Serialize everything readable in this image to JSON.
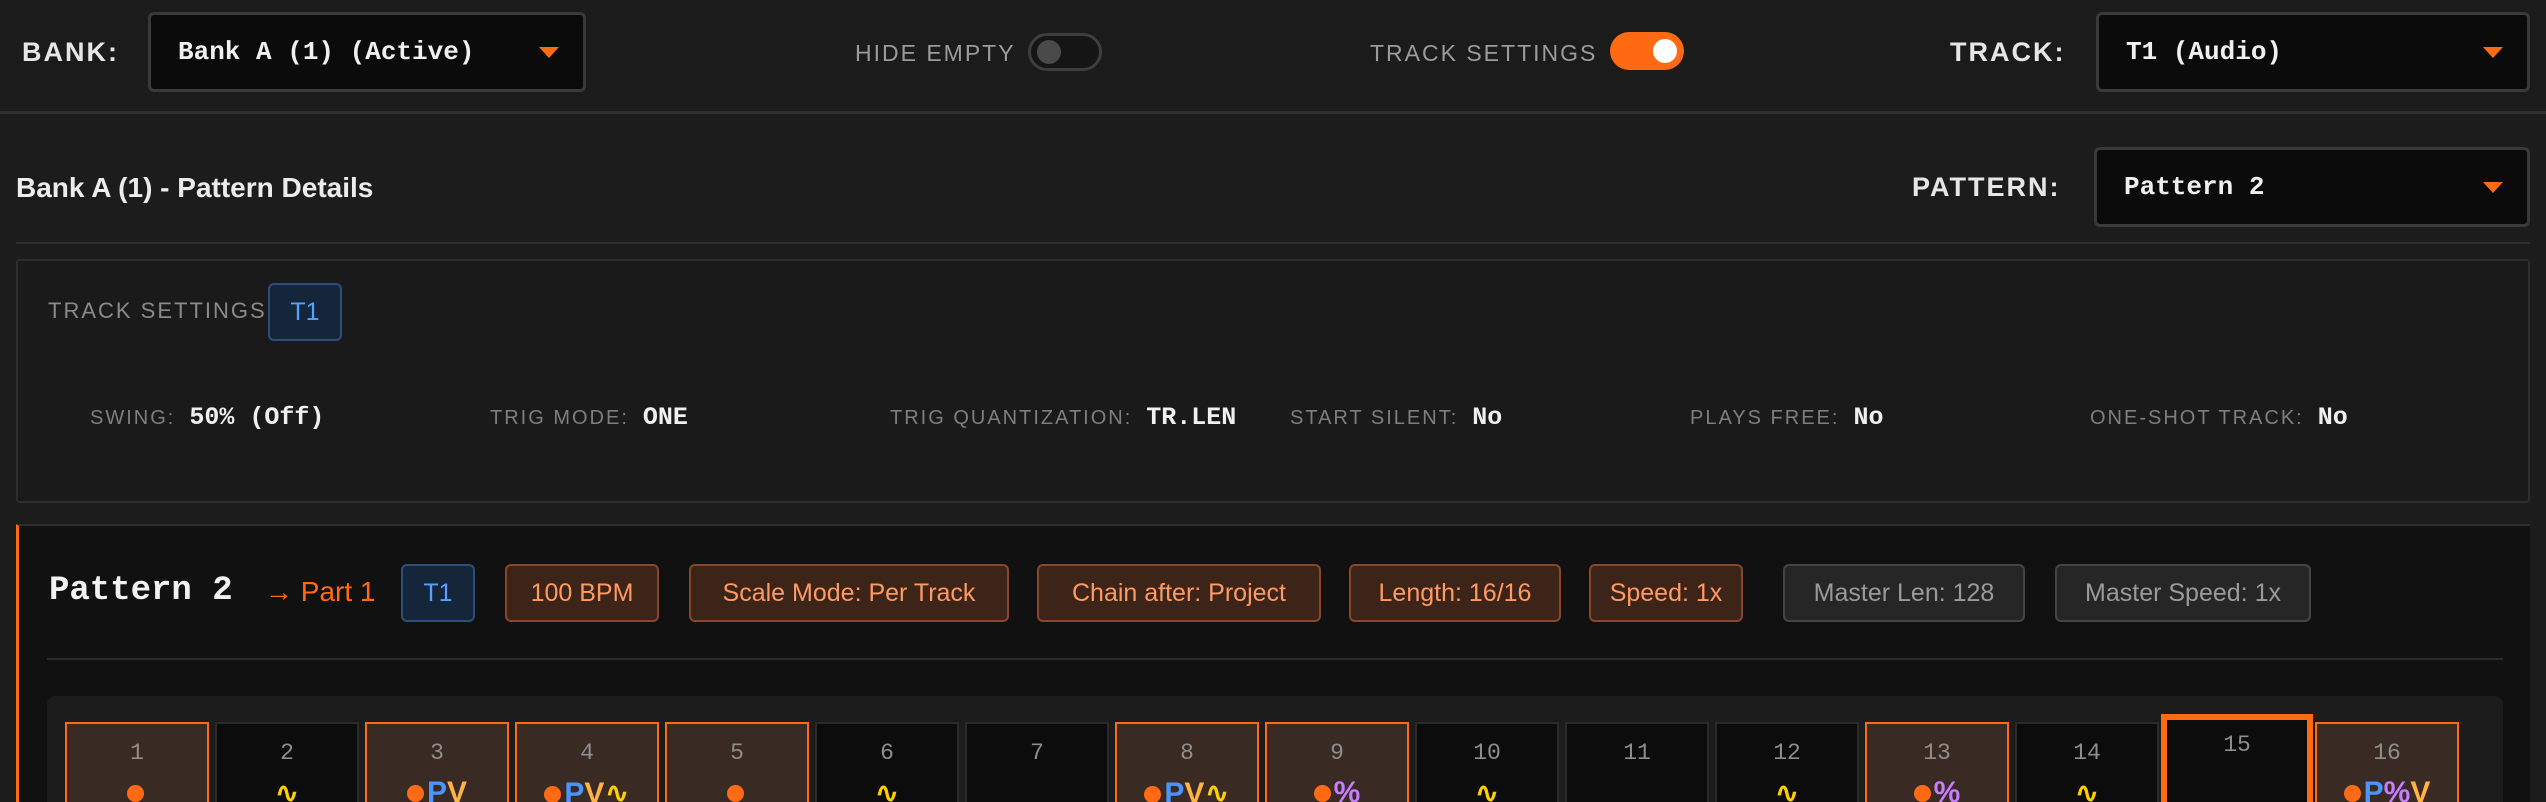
{
  "topbar": {
    "bank_label": "BANK:",
    "bank_value": "Bank A (1) (Active)",
    "hide_empty_label": "HIDE EMPTY",
    "hide_empty_on": false,
    "track_settings_label": "TRACK SETTINGS",
    "track_settings_on": true,
    "track_label": "TRACK:",
    "track_value": "T1 (Audio)"
  },
  "details": {
    "title": "Bank A (1) - Pattern Details",
    "pattern_label": "PATTERN:",
    "pattern_value": "Pattern 2"
  },
  "track_settings": {
    "title": "TRACK SETTINGS",
    "track_chip": "T1",
    "items": [
      {
        "key": "SWING:",
        "value": "50% (Off)"
      },
      {
        "key": "TRIG MODE:",
        "value": "ONE"
      },
      {
        "key": "TRIG QUANTIZATION:",
        "value": "TR.LEN"
      },
      {
        "key": "START SILENT:",
        "value": "No"
      },
      {
        "key": "PLAYS FREE:",
        "value": "No"
      },
      {
        "key": "ONE-SHOT TRACK:",
        "value": "No"
      }
    ]
  },
  "pattern": {
    "name": "Pattern 2",
    "part_link": "→ Part 1",
    "chips": [
      {
        "text": "T1",
        "style": "blue"
      },
      {
        "text": "100 BPM",
        "style": "orange"
      },
      {
        "text": "Scale Mode: Per Track",
        "style": "orange"
      },
      {
        "text": "Chain after: Project",
        "style": "orange"
      },
      {
        "text": "Length: 16/16",
        "style": "orange"
      },
      {
        "text": "Speed: 1x",
        "style": "orange"
      },
      {
        "text": "Master Len: 128",
        "style": "gray"
      },
      {
        "text": "Master Speed: 1x",
        "style": "gray"
      }
    ],
    "current_step": 15,
    "steps": [
      {
        "num": "1",
        "trig": true,
        "marks": [
          "dot"
        ]
      },
      {
        "num": "2",
        "trig": false,
        "marks": [
          "wave"
        ]
      },
      {
        "num": "3",
        "trig": true,
        "marks": [
          "dot",
          "P",
          "V"
        ]
      },
      {
        "num": "4",
        "trig": true,
        "marks": [
          "dot",
          "P",
          "V",
          "wave"
        ]
      },
      {
        "num": "5",
        "trig": true,
        "marks": [
          "dot"
        ]
      },
      {
        "num": "6",
        "trig": false,
        "marks": [
          "wave"
        ]
      },
      {
        "num": "7",
        "trig": false,
        "marks": []
      },
      {
        "num": "8",
        "trig": true,
        "marks": [
          "dot",
          "P",
          "V",
          "wave"
        ]
      },
      {
        "num": "9",
        "trig": true,
        "marks": [
          "dot",
          "%"
        ]
      },
      {
        "num": "10",
        "trig": false,
        "marks": [
          "wave"
        ]
      },
      {
        "num": "11",
        "trig": false,
        "marks": []
      },
      {
        "num": "12",
        "trig": false,
        "marks": [
          "wave"
        ]
      },
      {
        "num": "13",
        "trig": true,
        "marks": [
          "dot",
          "%"
        ]
      },
      {
        "num": "14",
        "trig": false,
        "marks": [
          "wave"
        ]
      },
      {
        "num": "15",
        "trig": false,
        "marks": []
      },
      {
        "num": "16",
        "trig": true,
        "marks": [
          "dot",
          "P",
          "%",
          "V"
        ]
      }
    ]
  },
  "icons": {
    "dropdown": "chevron-down-icon",
    "trig": "trig-dot-icon",
    "lock": "wave-icon"
  },
  "colors": {
    "accent": "#ff6a13",
    "chip_blue": "#56a0ff",
    "mark_p": "#4b95ff",
    "mark_v": "#ffb347",
    "mark_pct": "#c77dff",
    "mark_wave": "#ffd000"
  }
}
